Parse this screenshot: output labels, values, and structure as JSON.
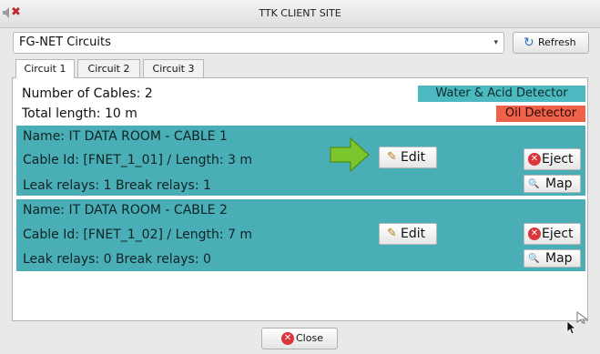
{
  "window": {
    "title": "TTK CLIENT SITE",
    "close_glyph": "✖",
    "speaker_icon": "speaker-icon"
  },
  "toolbar": {
    "selected_value": "FG-NET Circuits",
    "dropdown_glyph": "▾",
    "refresh_glyph": "↻",
    "refresh_label": "Refresh"
  },
  "tabs": [
    {
      "label": "Circuit 1",
      "active": true
    },
    {
      "label": "Circuit 2",
      "active": false
    },
    {
      "label": "Circuit 3",
      "active": false
    }
  ],
  "summary": {
    "cables": "Number of Cables: 2",
    "length": "Total length: 10 m",
    "water_badge": "Water & Acid Detector",
    "oil_badge": "Oil Detector"
  },
  "cables": [
    {
      "name": "Name: IT DATA ROOM - CABLE 1",
      "id_length": "Cable Id: [FNET_1_01] / Length: 3 m",
      "relays": "Leak relays: 1  Break relays: 1"
    },
    {
      "name": "Name: IT DATA ROOM - CABLE 2",
      "id_length": "Cable Id: [FNET_1_02] / Length: 7 m",
      "relays": "Leak relays: 0  Break relays: 0"
    }
  ],
  "actions": {
    "edit_label": "Edit",
    "edit_glyph": "✎",
    "eject_label": "Eject",
    "eject_glyph": "✕",
    "map_label": "Map",
    "map_glyph": "🔍"
  },
  "footer": {
    "close_label": "Close",
    "close_glyph": "✕"
  },
  "colors": {
    "water_badge": "#4cb8bf",
    "oil_badge": "#f06149",
    "cable_row": "#4aaeb6",
    "arrow": "#7cc52c"
  }
}
